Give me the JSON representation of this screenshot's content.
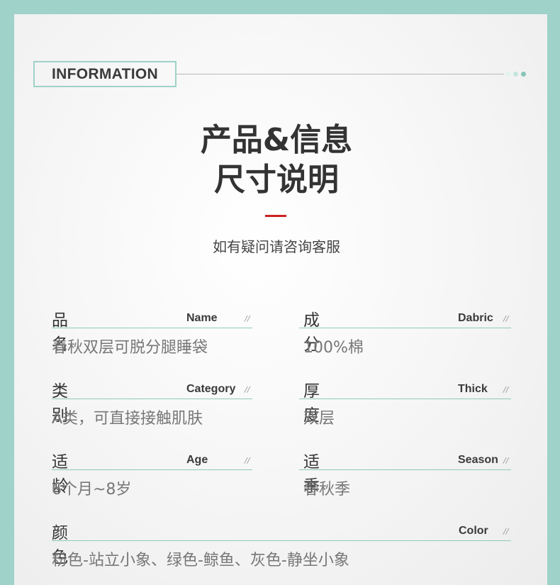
{
  "header": {
    "badge": "INFORMATION",
    "title_line1": "产品&信息",
    "title_line2": "尺寸说明",
    "subtitle": "如有疑问请咨询客服"
  },
  "fields": {
    "name": {
      "label": "品名",
      "en": "Name",
      "value": "春秋双层可脱分腿睡袋"
    },
    "fabric": {
      "label": "成分",
      "en": "Dabric",
      "value": "100%棉"
    },
    "category": {
      "label": "类别",
      "en": "Category",
      "value": "A类，可直接接触肌肤"
    },
    "thick": {
      "label": "厚度",
      "en": "Thick",
      "value": "双层"
    },
    "age": {
      "label": "适龄",
      "en": "Age",
      "value": "6个月~8岁"
    },
    "season": {
      "label": "适季",
      "en": "Season",
      "value": "春秋季"
    },
    "color": {
      "label": "颜色",
      "en": "Color",
      "value": "粉色-站立小象、绿色-鲸鱼、灰色-静坐小象"
    }
  },
  "slash": "//",
  "colors": {
    "frame": "#9fd2c8",
    "accent_red": "#cc2222",
    "underline": "#8fc9bd"
  }
}
